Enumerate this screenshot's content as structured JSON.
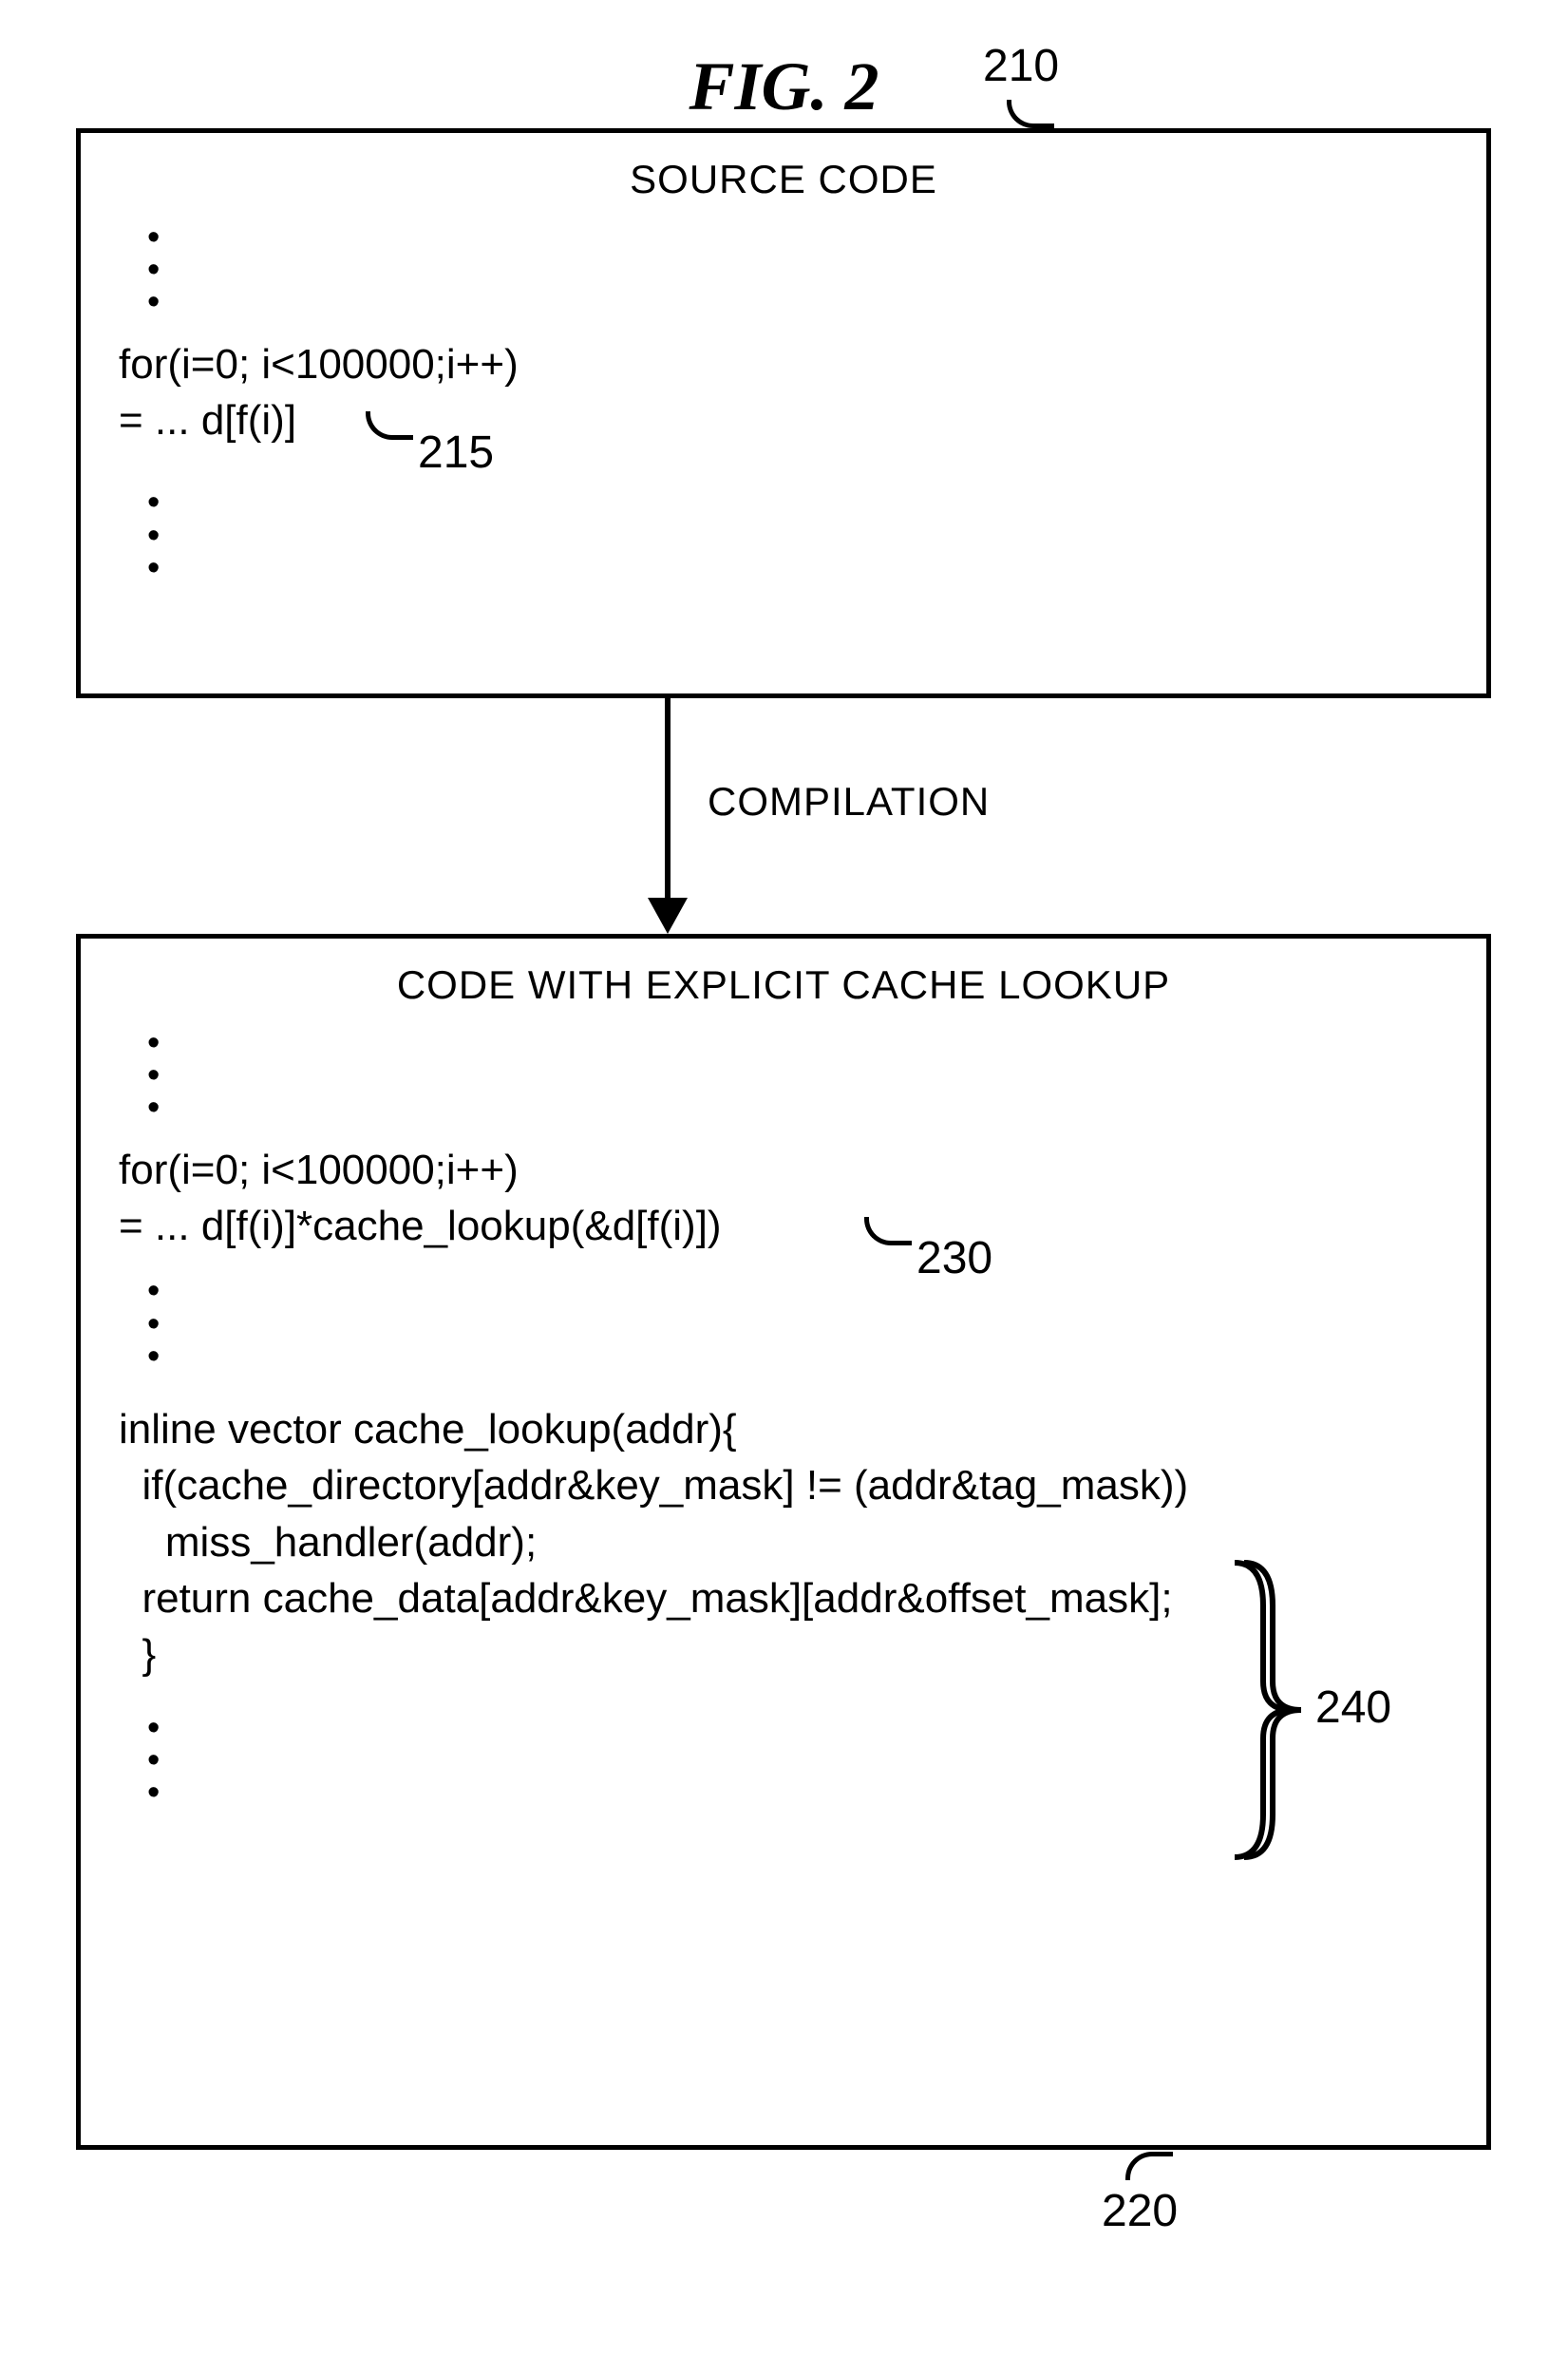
{
  "figure": {
    "title": "FIG. 2",
    "arrow_label": "COMPILATION"
  },
  "box1": {
    "title": "SOURCE CODE",
    "ref": "210",
    "code": {
      "line1": "for(i=0; i<100000;i++)",
      "line2": "= ... d[f(i)]",
      "line2_ref": "215"
    }
  },
  "box2": {
    "title": "CODE WITH EXPLICIT CACHE LOOKUP",
    "ref": "220",
    "code": {
      "line1": "for(i=0; i<100000;i++)",
      "line2": "= ... d[f(i)]*cache_lookup(&d[f(i)])",
      "line2_ref": "230",
      "fn1": "inline vector cache_lookup(addr){",
      "fn2": "  if(cache_directory[addr&key_mask] != (addr&tag_mask))",
      "fn3": "    miss_handler(addr);",
      "fn4": "  return cache_data[addr&key_mask][addr&offset_mask];",
      "fn5": "  }",
      "fn_ref": "240"
    }
  }
}
